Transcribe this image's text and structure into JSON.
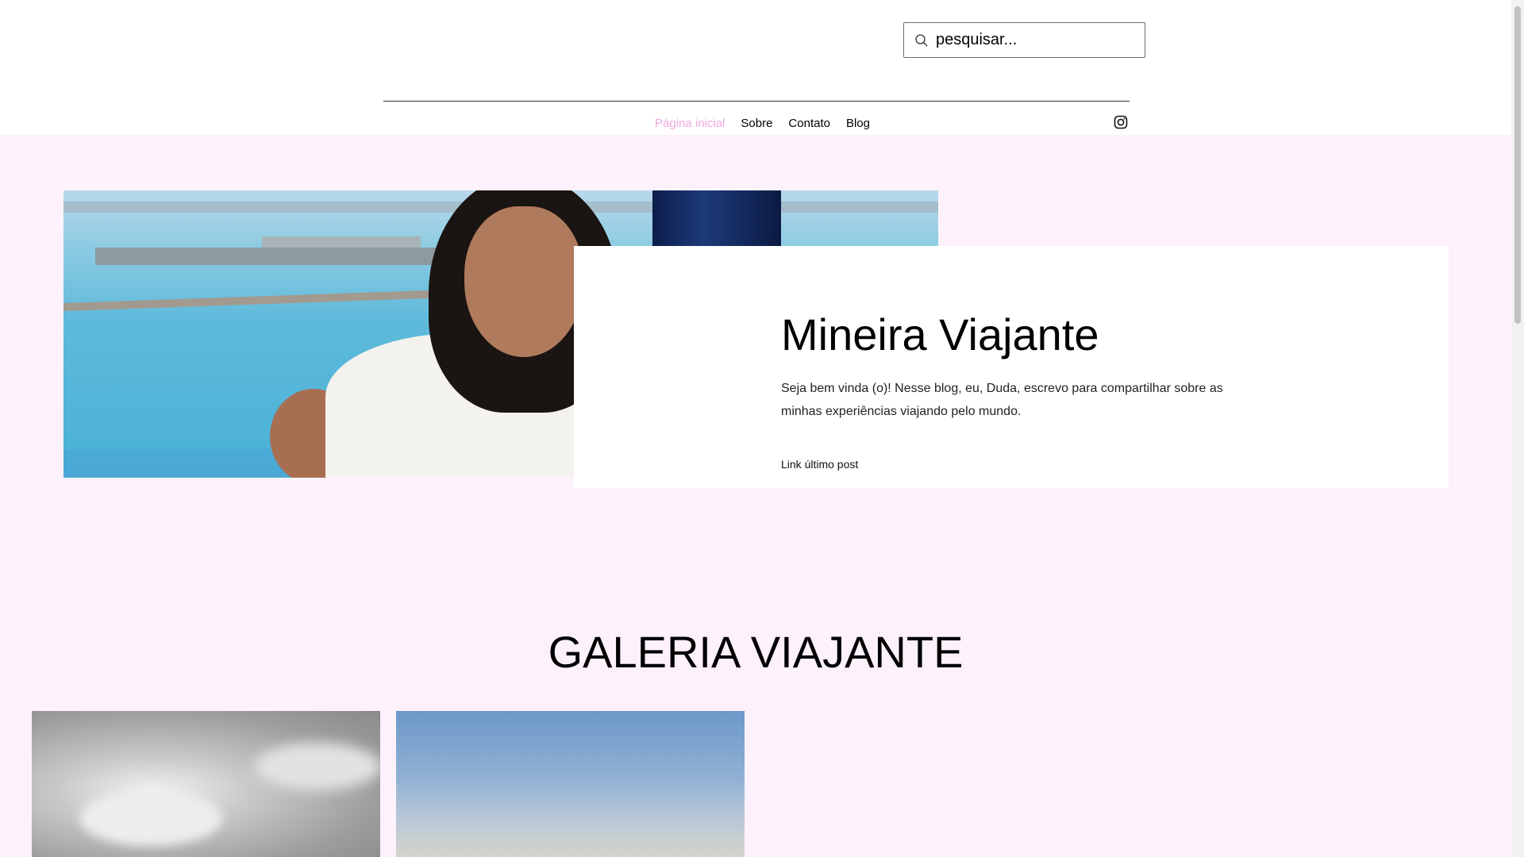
{
  "header": {
    "search": {
      "placeholder": "pesquisar..."
    },
    "nav": [
      {
        "label": "Página inicial",
        "active": true
      },
      {
        "label": "Sobre",
        "active": false
      },
      {
        "label": "Contato",
        "active": false
      },
      {
        "label": "Blog",
        "active": false
      }
    ],
    "social": {
      "icon": "instagram-icon"
    }
  },
  "hero": {
    "title": "Mineira Viajante",
    "description": "Seja bem vinda (o)! Nesse blog, eu, Duda, escrevo para compartilhar sobre as minhas experiências viajando pelo mundo.",
    "link_label": "Link último post"
  },
  "gallery": {
    "title": "GALERIA VIAJANTE"
  },
  "colors": {
    "accent_nav_active": "#f0a8e0",
    "section_background": "#fdf1fb"
  }
}
